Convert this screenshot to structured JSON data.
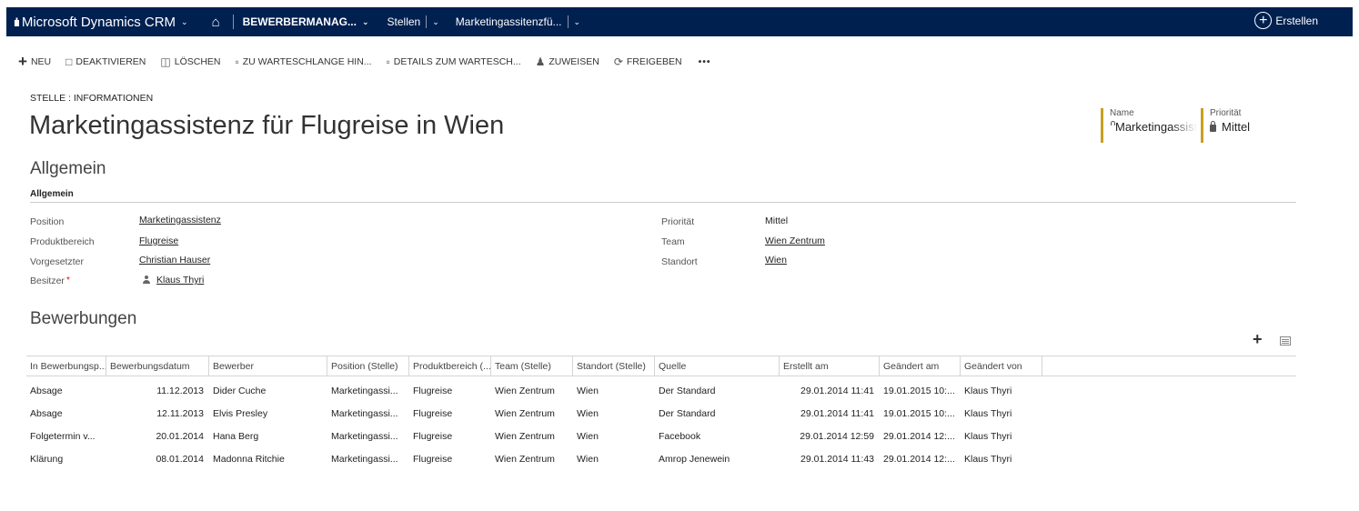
{
  "nav": {
    "app_name": "Microsoft Dynamics CRM",
    "area": "BEWERBERMANAG...",
    "entity": "Stellen",
    "record": "Marketingassitenzfü...",
    "create_label": "Erstellen"
  },
  "commands": {
    "new": "NEU",
    "deactivate": "DEAKTIVIEREN",
    "delete": "LÖSCHEN",
    "add_to_queue": "ZU WARTESCHLANGE HIN...",
    "queue_details": "DETAILS ZUM WARTESCH...",
    "assign": "ZUWEISEN",
    "share": "FREIGEBEN",
    "more": "•••"
  },
  "header": {
    "entity_label": "STELLE : INFORMATIONEN",
    "title": "Marketingassistenz für Flugreise in Wien",
    "fields": [
      {
        "label": "Name",
        "value": "Marketingassistenz"
      },
      {
        "label": "Priorität",
        "value": "Mittel"
      }
    ]
  },
  "general": {
    "tab_title": "Allgemein",
    "section_title": "Allgemein",
    "left": [
      {
        "label": "Position",
        "value": "Marketingassistenz"
      },
      {
        "label": "Produktbereich",
        "value": "Flugreise"
      },
      {
        "label": "Vorgesetzter",
        "value": "Christian Hauser"
      },
      {
        "label": "Besitzer",
        "value": "Klaus Thyri",
        "required": "*"
      }
    ],
    "right": [
      {
        "label": "Priorität",
        "value": "Mittel"
      },
      {
        "label": "Team",
        "value": "Wien Zentrum"
      },
      {
        "label": "Standort",
        "value": "Wien"
      }
    ]
  },
  "applications": {
    "title": "Bewerbungen",
    "add_icon": "+",
    "columns": [
      "In Bewerbungsp...",
      "Bewerbungsdatum",
      "Bewerber",
      "Position (Stelle)",
      "Produktbereich (...",
      "Team (Stelle)",
      "Standort (Stelle)",
      "Quelle",
      "Erstellt am",
      "Geändert am",
      "Geändert von"
    ],
    "rows": [
      [
        "Absage",
        "11.12.2013",
        "Dider Cuche",
        "Marketingassi...",
        "Flugreise",
        "Wien Zentrum",
        "Wien",
        "Der Standard",
        "29.01.2014 11:41",
        "19.01.2015 10:...",
        "Klaus Thyri"
      ],
      [
        "Absage",
        "12.11.2013",
        "Elvis Presley",
        "Marketingassi...",
        "Flugreise",
        "Wien Zentrum",
        "Wien",
        "Der Standard",
        "29.01.2014 11:41",
        "19.01.2015 10:...",
        "Klaus Thyri"
      ],
      [
        "Folgetermin v...",
        "20.01.2014",
        "Hana Berg",
        "Marketingassi...",
        "Flugreise",
        "Wien Zentrum",
        "Wien",
        "Facebook",
        "29.01.2014 12:59",
        "29.01.2014 12:...",
        "Klaus Thyri"
      ],
      [
        "Klärung",
        "08.01.2014",
        "Madonna Ritchie",
        "Marketingassi...",
        "Flugreise",
        "Wien Zentrum",
        "Wien",
        "Amrop Jenewein",
        "29.01.2014 11:43",
        "29.01.2014 12:...",
        "Klaus Thyri"
      ]
    ]
  },
  "colors": {
    "nav_bg": "#002050",
    "header_field_accent": "#c8a020",
    "required": "#ee0000"
  },
  "icons": [
    "dynamics-logo-icon",
    "home-icon",
    "create-icon",
    "plus-icon",
    "deactivate-icon",
    "delete-icon",
    "queue-add-icon",
    "queue-details-icon",
    "assign-icon",
    "share-icon",
    "lock-icon",
    "user-icon",
    "view-icon"
  ]
}
